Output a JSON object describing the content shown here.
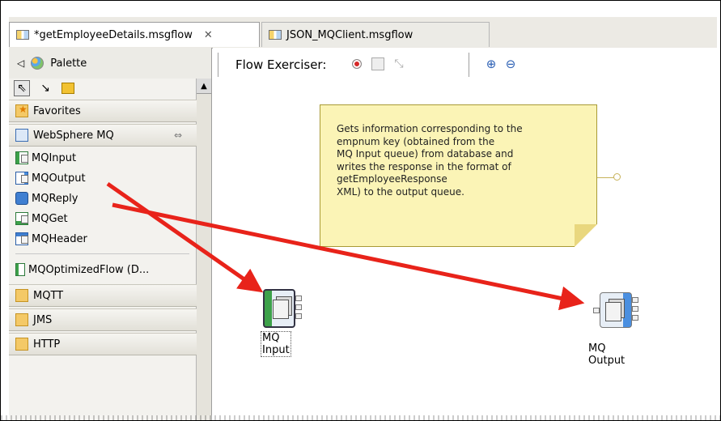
{
  "tabs": [
    {
      "label": "*getEmployeeDetails.msgflow",
      "active": true
    },
    {
      "label": "JSON_MQClient.msgflow",
      "active": false
    }
  ],
  "palette": {
    "title": "Palette",
    "drawers": {
      "favorites": "Favorites",
      "websphere_mq": "WebSphere MQ",
      "mqtt": "MQTT",
      "jms": "JMS",
      "http": "HTTP"
    },
    "items": [
      "MQInput",
      "MQOutput",
      "MQReply",
      "MQGet",
      "MQHeader",
      "MQOptimizedFlow (D..."
    ]
  },
  "toolbar": {
    "flow_exerciser_label": "Flow Exerciser:"
  },
  "canvas": {
    "note_lines": [
      "Gets information corresponding to the",
      "empnum key (obtained from the",
      "MQ Input queue) from database and",
      "writes the response in the format of",
      "getEmployeeResponse",
      "XML) to the output queue."
    ],
    "nodes": {
      "mq_input": "MQ Input",
      "mq_output": "MQ Output"
    }
  },
  "colors": {
    "arrow": "#e8231a",
    "note_bg": "#fbf4b6",
    "node_accent_green": "#3da14a",
    "node_accent_blue": "#4a8fe0"
  }
}
